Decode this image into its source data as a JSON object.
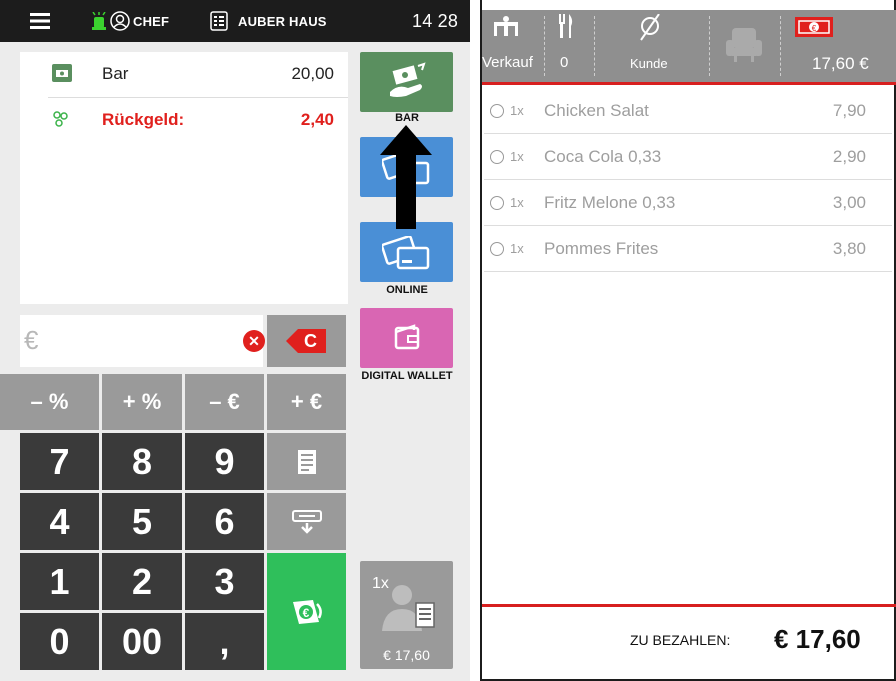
{
  "topbar": {
    "user": "CHEF",
    "location": "AUBER HAUS",
    "time": "14 28"
  },
  "receipt": {
    "rows": [
      {
        "label": "Bar",
        "value": "20,00"
      },
      {
        "label": "Rückgeld:",
        "value": "2,40"
      }
    ]
  },
  "amount_input": {
    "placeholder": "€"
  },
  "buttons": {
    "clear": "C",
    "discount_minus_pct": "– %",
    "discount_plus_pct": "+ %",
    "discount_minus_eur": "– €",
    "discount_plus_eur": "+ €"
  },
  "keypad": [
    "7",
    "8",
    "9",
    "4",
    "5",
    "6",
    "1",
    "2",
    "3",
    "0",
    "00",
    ","
  ],
  "payment_methods": {
    "bar": "BAR",
    "online": "ONLINE",
    "digital_wallet": "DIGITAL WALLET",
    "split_qty": "1x",
    "split_total": "€ 17,60"
  },
  "order_header": {
    "mode": "Verkauf",
    "covers": "0",
    "customer": "Kunde",
    "total": "17,60 €"
  },
  "order_items": [
    {
      "qty": "1x",
      "name": "Chicken Salat",
      "price": "7,90"
    },
    {
      "qty": "1x",
      "name": "Coca Cola 0,33",
      "price": "2,90"
    },
    {
      "qty": "1x",
      "name": "Fritz Melone 0,33",
      "price": "3,00"
    },
    {
      "qty": "1x",
      "name": "Pommes Frites",
      "price": "3,80"
    }
  ],
  "footer": {
    "label": "ZU BEZAHLEN:",
    "total": "€ 17,60"
  },
  "colors": {
    "accent_red": "#e0201d",
    "cash_green": "#5a8f5f",
    "card_blue": "#4a8fd6",
    "wallet_pink": "#d966b3",
    "pay_green": "#2fbf5b"
  }
}
